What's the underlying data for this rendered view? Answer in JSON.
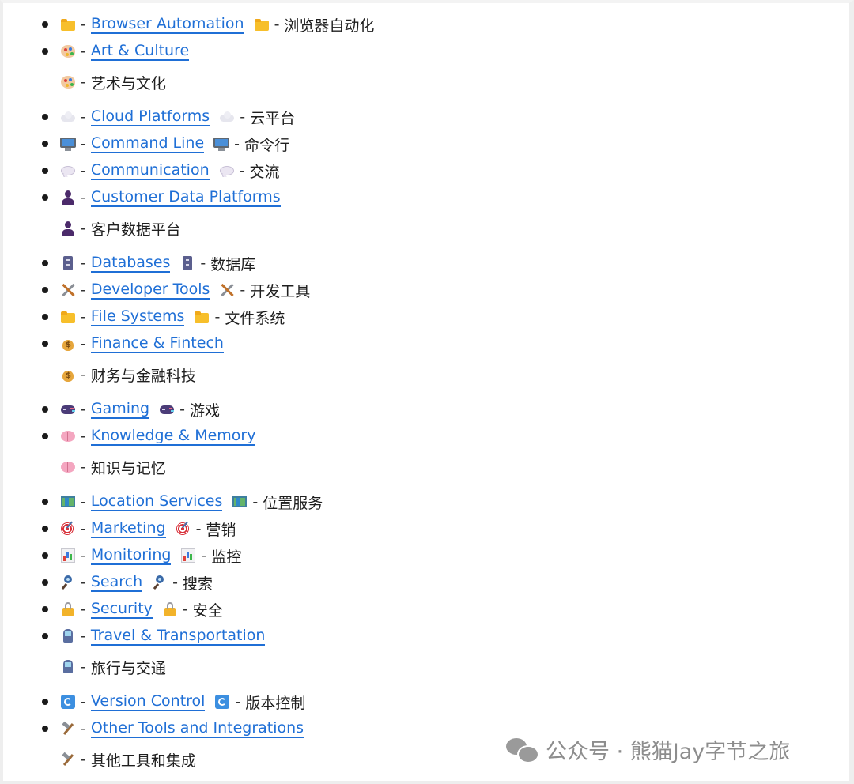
{
  "items": [
    {
      "emoji": "folder",
      "link": "Browser Automation",
      "zh": "浏览器自动化",
      "inline": true
    },
    {
      "emoji": "palette",
      "link": "Art & Culture",
      "zh": "艺术与文化",
      "inline": false
    },
    {
      "emoji": "cloud",
      "link": "Cloud Platforms",
      "zh": "云平台",
      "inline": true
    },
    {
      "emoji": "monitor",
      "link": "Command Line",
      "zh": "命令行",
      "inline": true
    },
    {
      "emoji": "speech",
      "link": "Communication",
      "zh": "交流",
      "inline": true
    },
    {
      "emoji": "person",
      "link": "Customer Data Platforms",
      "zh": "客户数据平台",
      "inline": false
    },
    {
      "emoji": "cabinet",
      "link": "Databases",
      "zh": "数据库",
      "inline": true
    },
    {
      "emoji": "tools",
      "link": "Developer Tools",
      "zh": "开发工具",
      "inline": true
    },
    {
      "emoji": "folder",
      "link": "File Systems",
      "zh": "文件系统",
      "inline": true
    },
    {
      "emoji": "moneybag",
      "link": "Finance & Fintech",
      "zh": "财务与金融科技",
      "inline": false
    },
    {
      "emoji": "gamepad",
      "link": "Gaming",
      "zh": "游戏",
      "inline": true
    },
    {
      "emoji": "brain",
      "link": "Knowledge & Memory",
      "zh": "知识与记忆",
      "inline": false
    },
    {
      "emoji": "map",
      "link": "Location Services",
      "zh": "位置服务",
      "inline": true
    },
    {
      "emoji": "target",
      "link": "Marketing",
      "zh": "营销",
      "inline": true
    },
    {
      "emoji": "barchart",
      "link": "Monitoring",
      "zh": "监控",
      "inline": true
    },
    {
      "emoji": "magnifier",
      "link": "Search",
      "zh": "搜索",
      "inline": true
    },
    {
      "emoji": "lock",
      "link": "Security",
      "zh": "安全",
      "inline": true
    },
    {
      "emoji": "tram",
      "link": "Travel & Transportation",
      "zh": "旅行与交通",
      "inline": false
    },
    {
      "emoji": "refresh",
      "link": "Version Control",
      "zh": "版本控制",
      "inline": true
    },
    {
      "emoji": "hammer",
      "link": "Other Tools and Integrations",
      "zh": "其他工具和集成",
      "inline": false
    }
  ],
  "separator": "-",
  "watermark": {
    "text": "公众号 · 熊猫Jay字节之旅",
    "icon": "wechat-icon"
  }
}
